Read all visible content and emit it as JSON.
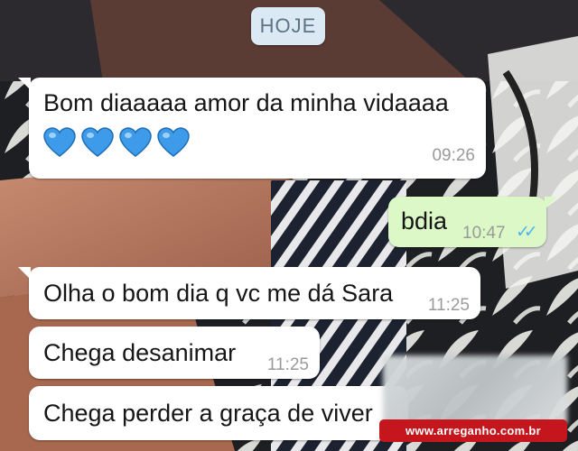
{
  "chat": {
    "date_chip": "HOJE",
    "messages": [
      {
        "direction": "incoming",
        "text": "Bom diaaaaa amor da minha vidaaaa",
        "emoji_icons": [
          "blue-heart-icon",
          "blue-heart-icon",
          "blue-heart-icon",
          "blue-heart-icon"
        ],
        "time": "09:26"
      },
      {
        "direction": "outgoing",
        "text": "bdia",
        "time": "10:47",
        "status_icon": "double-check-read-icon"
      },
      {
        "direction": "incoming",
        "text": "Olha o bom dia q vc me dá Sara",
        "time": "11:25"
      },
      {
        "direction": "incoming",
        "text": "Chega desanimar",
        "time": "11:25"
      },
      {
        "direction": "incoming",
        "text": "Chega perder a graça de viver",
        "time": ""
      }
    ]
  },
  "watermark": {
    "text": "www.arreganho.com.br"
  },
  "colors": {
    "incoming_bubble": "#ffffff",
    "outgoing_bubble": "#dcf8c6",
    "date_chip": "#dbe9f4",
    "read_ticks": "#4fb6ec",
    "heart": "#3d9be9",
    "watermark_bg": "#c4161c"
  }
}
